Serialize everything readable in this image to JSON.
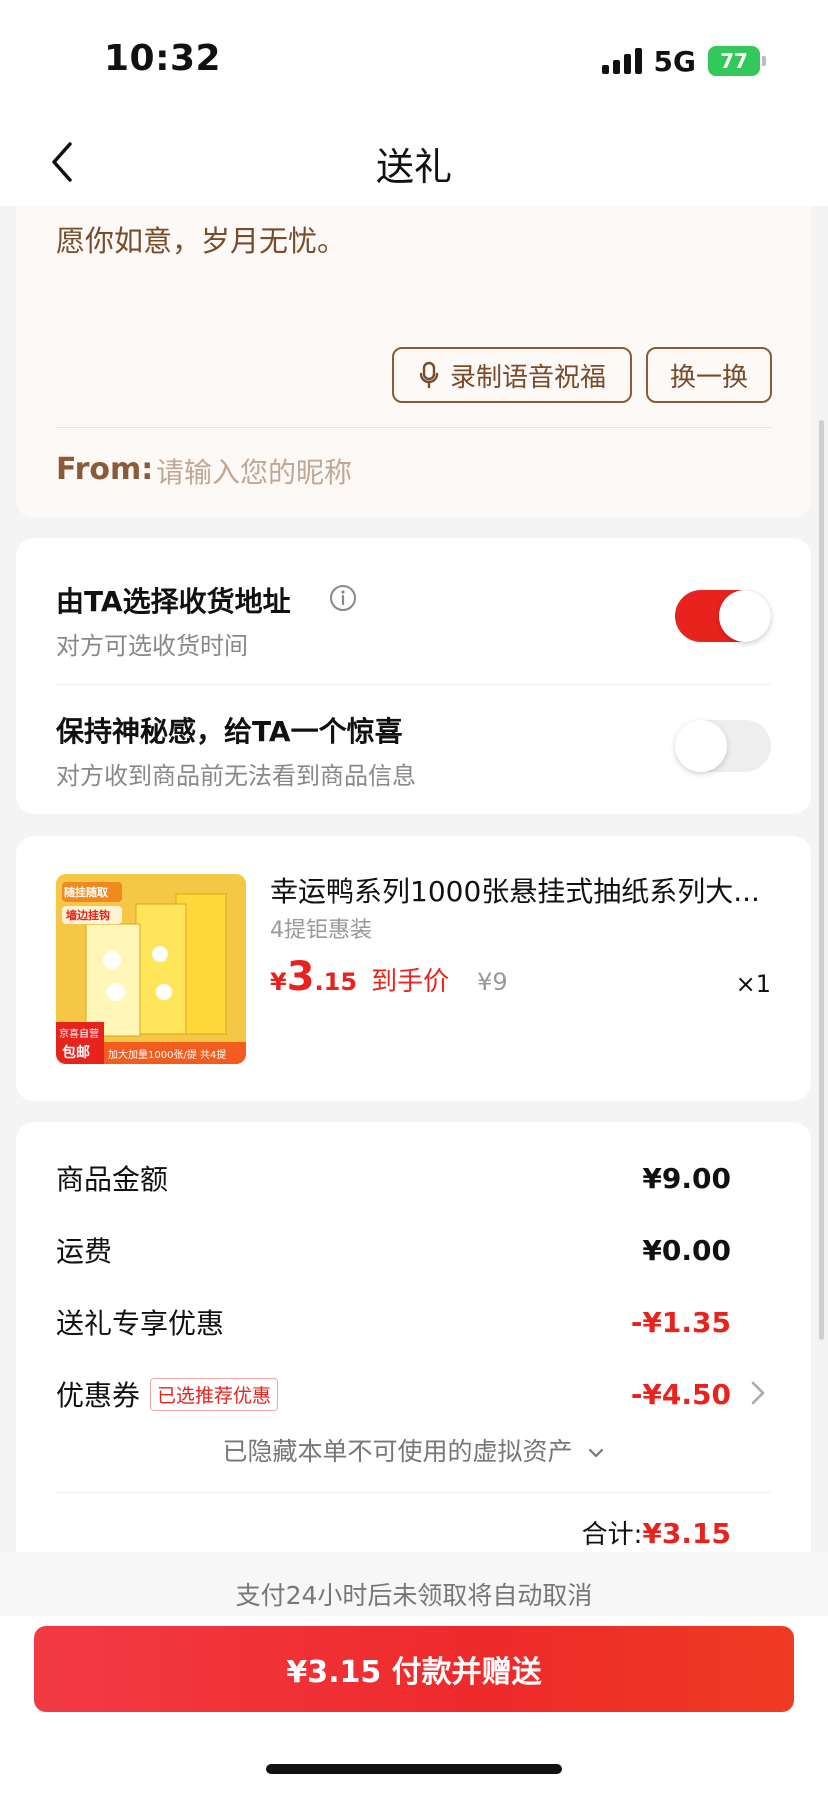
{
  "status_bar": {
    "time": "10:32",
    "network": "5G",
    "battery": "77"
  },
  "nav": {
    "title": "送礼"
  },
  "greeting": {
    "message": "愿你如意，岁月无忧。",
    "voice_button": "录制语音祝福",
    "swap_button": "换一换",
    "from_label": "From:",
    "from_placeholder": "请输入您的昵称",
    "from_value": ""
  },
  "options": [
    {
      "title": "由TA选择收货地址",
      "subtitle": "对方可选收货时间",
      "enabled": true
    },
    {
      "title": "保持神秘感，给TA一个惊喜",
      "subtitle": "对方收到商品前无法看到商品信息",
      "enabled": false
    }
  ],
  "product": {
    "name": "幸运鸭系列1000张悬挂式抽纸系列大...",
    "spec": "4提钜惠装",
    "price_currency": "¥",
    "price_int": "3",
    "price_dec": ".15",
    "price_tag": "到手价",
    "original_price": "¥9",
    "quantity": "×1",
    "image": {
      "badge_top": "随挂随取",
      "badge_sub": "墙边挂钩",
      "badge_store": "京喜自营",
      "badge_ship": "包邮",
      "footer": "加大加量1000张/提 共4提"
    }
  },
  "summary": {
    "rows": [
      {
        "label": "商品金额",
        "value": "¥9.00"
      },
      {
        "label": "运费",
        "value": "¥0.00"
      },
      {
        "label": "送礼专享优惠",
        "value": "-¥1.35"
      },
      {
        "label": "优惠券",
        "badge": "已选推荐优惠",
        "value": "-¥4.50"
      }
    ],
    "hidden_assets": "已隐藏本单不可使用的虚拟资产",
    "total_label": "合计:",
    "total_value": "¥3.15"
  },
  "bottom": {
    "notice": "支付24小时后未领取将自动取消",
    "pay_button": "¥3.15 付款并赠送"
  },
  "colors": {
    "accent": "#e8231e",
    "brown": "#7a4b2a",
    "toggle_off": "#eeeeee"
  }
}
